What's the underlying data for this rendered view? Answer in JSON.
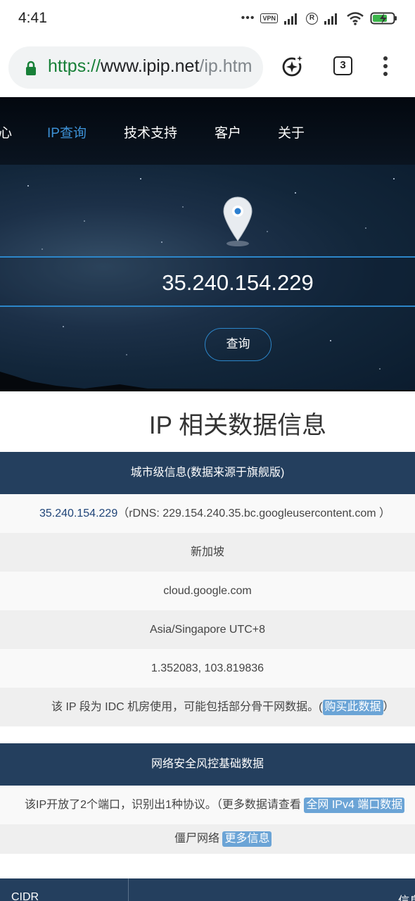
{
  "status_bar": {
    "time": "4:41",
    "vpn_label": "VPN",
    "reg_mark": "R",
    "icons": [
      "dots-icon",
      "vpn-icon",
      "signal-icon",
      "registered-icon",
      "signal-icon",
      "wifi-icon",
      "battery-charging-icon"
    ]
  },
  "browser": {
    "url_scheme": "https://",
    "url_host": "www.ipip.net",
    "url_path": "/ip.htm",
    "tab_count": "3"
  },
  "nav": {
    "items": [
      {
        "label": "心"
      },
      {
        "label": "IP查询",
        "active": true
      },
      {
        "label": "技术支持"
      },
      {
        "label": "客户"
      },
      {
        "label": "关于"
      }
    ]
  },
  "hero": {
    "ip_value": "35.240.154.229",
    "query_label": "查询"
  },
  "section": {
    "title": "IP 相关数据信息"
  },
  "city_table": {
    "header": "城市级信息(数据来源于旗舰版)",
    "ip_link": "35.240.154.229",
    "rdns_text": "（rDNS: 229.154.240.35.bc.googleusercontent.com ）",
    "location": "新加坡",
    "org": "cloud.google.com",
    "timezone": "Asia/Singapore UTC+8",
    "coordinates": "1.352083, 103.819836",
    "idc_text": "该 IP 段为 IDC 机房使用，可能包括部分骨干网数据。(",
    "buy_link": "购买此数据",
    "idc_close": "）"
  },
  "security_table": {
    "header": "网络安全风控基础数据",
    "ports_text": "该IP开放了2个端口，识别出1种协议。（更多数据请查看",
    "ports_link": "全网 IPv4 端口数据",
    "botnet_text": "僵尸网络",
    "more_link": "更多信息"
  },
  "bottom_table": {
    "col1": "CIDR",
    "col2": "信息"
  },
  "colors": {
    "nav_active": "#3d91d6",
    "header_bg": "#243f5e",
    "link_tag_bg": "#6ba4d6",
    "url_scheme": "#188038"
  }
}
